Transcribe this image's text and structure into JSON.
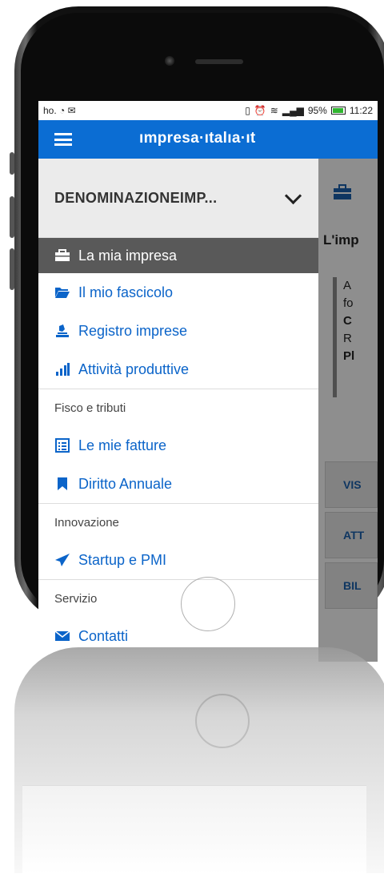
{
  "statusbar": {
    "left": "ho.",
    "battery_pct": "95%",
    "time": "11:22"
  },
  "appbar": {
    "brand": "ımpresa·ıtalıa·ıt"
  },
  "drawer": {
    "company": "DENOMINAZIONEIMP...",
    "items": [
      {
        "label": "La mia impresa",
        "icon": "briefcase-icon",
        "active": true
      },
      {
        "label": "Il mio fascicolo",
        "icon": "folder-open-icon"
      },
      {
        "label": "Registro imprese",
        "icon": "stamp-icon"
      },
      {
        "label": "Attività produttive",
        "icon": "signal-bars-icon"
      }
    ],
    "sections": [
      {
        "title": "Fisco e tributi",
        "items": [
          {
            "label": "Le mie fatture",
            "icon": "list-document-icon"
          },
          {
            "label": "Diritto Annuale",
            "icon": "bookmark-icon"
          }
        ]
      },
      {
        "title": "Innovazione",
        "items": [
          {
            "label": "Startup e PMI",
            "icon": "paper-plane-icon"
          }
        ]
      },
      {
        "title": "Servizio",
        "items": [
          {
            "label": "Contatti",
            "icon": "envelope-icon"
          }
        ]
      }
    ]
  },
  "background_page": {
    "title": "L'imp",
    "card_lines": [
      "A",
      "fo",
      "C",
      "R",
      "Pl"
    ],
    "buttons": [
      "VIS",
      "ATT",
      "BIL"
    ]
  },
  "colors": {
    "appbar": "#0b6dd3",
    "link": "#0b64c9",
    "active_item": "#595959"
  }
}
